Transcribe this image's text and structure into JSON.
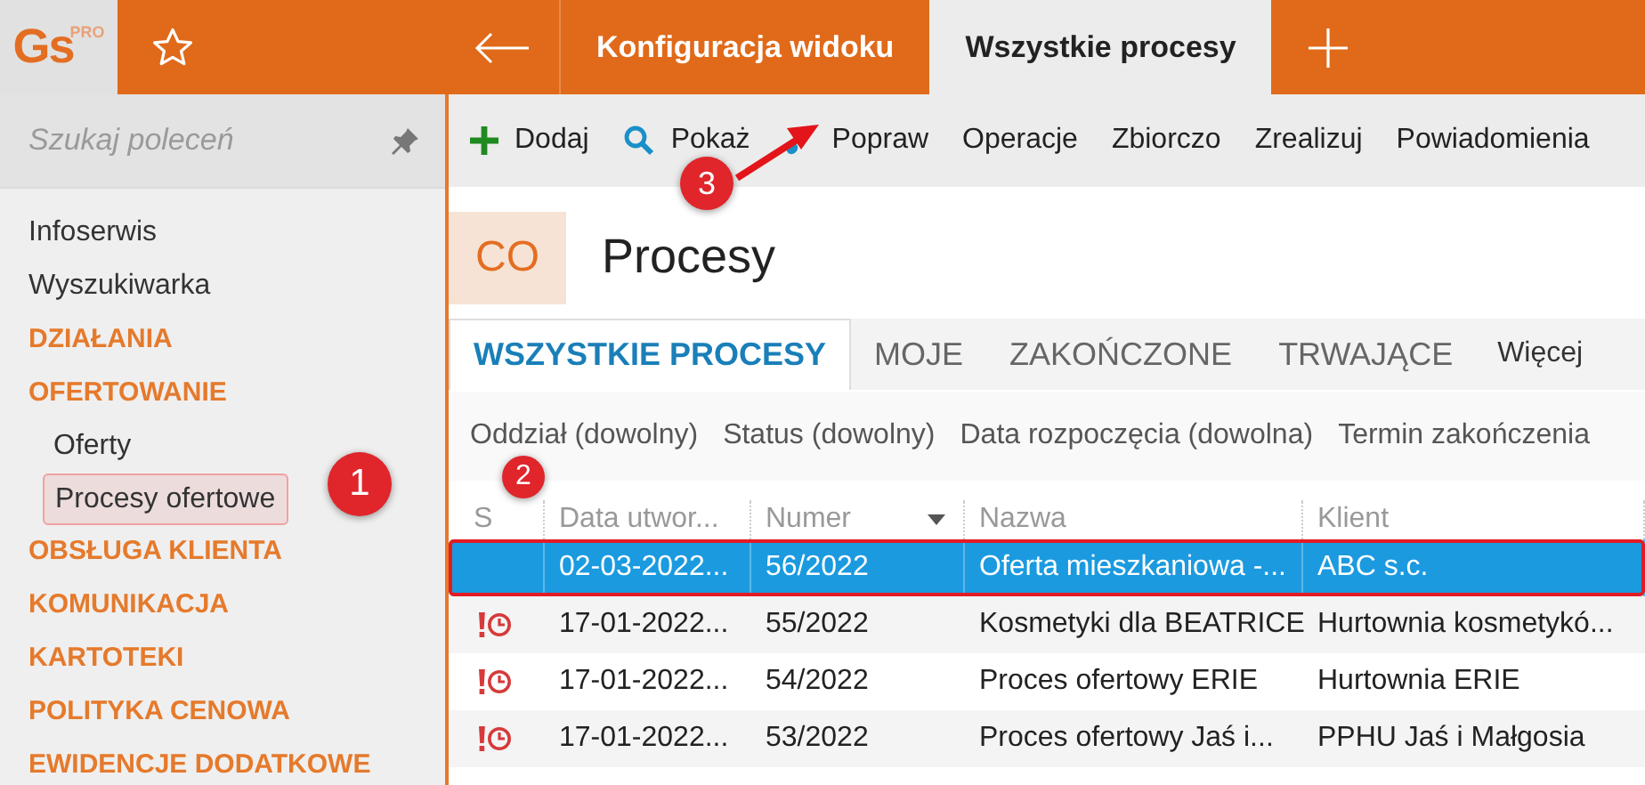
{
  "logo": {
    "text": "Gs",
    "badge": "PRO"
  },
  "top_tabs": [
    {
      "label": "Konfiguracja widoku",
      "selected": false
    },
    {
      "label": "Wszystkie procesy",
      "selected": true
    }
  ],
  "sidebar": {
    "search": {
      "placeholder": "Szukaj poleceń"
    },
    "items": [
      {
        "label": "Infoserwis",
        "kind": "link"
      },
      {
        "label": "Wyszukiwarka",
        "kind": "link"
      },
      {
        "label": "DZIAŁANIA",
        "kind": "section"
      },
      {
        "label": "OFERTOWANIE",
        "kind": "section",
        "children": [
          {
            "label": "Oferty",
            "selected": false
          },
          {
            "label": "Procesy ofertowe",
            "selected": true
          }
        ]
      },
      {
        "label": "OBSŁUGA KLIENTA",
        "kind": "section"
      },
      {
        "label": "KOMUNIKACJA",
        "kind": "section"
      },
      {
        "label": "KARTOTEKI",
        "kind": "section"
      },
      {
        "label": "POLITYKA CENOWA",
        "kind": "section"
      },
      {
        "label": "EWIDENCJE DODATKOWE",
        "kind": "section"
      }
    ]
  },
  "toolbar": [
    {
      "label": "Dodaj",
      "kind": "add"
    },
    {
      "label": "Pokaż",
      "kind": "search"
    },
    {
      "label": "Popraw",
      "kind": "edit"
    },
    {
      "label": "Operacje",
      "kind": "plain"
    },
    {
      "label": "Zbiorczo",
      "kind": "plain"
    },
    {
      "label": "Zrealizuj",
      "kind": "plain"
    },
    {
      "label": "Powiadomienia",
      "kind": "plain"
    }
  ],
  "header": {
    "badge": "CO",
    "title": "Procesy"
  },
  "view_tabs": [
    {
      "label": "WSZYSTKIE PROCESY",
      "selected": true
    },
    {
      "label": "MOJE",
      "selected": false
    },
    {
      "label": "ZAKOŃCZONE",
      "selected": false
    },
    {
      "label": "TRWAJĄCE",
      "selected": false
    }
  ],
  "more": "Więcej",
  "filters": [
    "Oddział (dowolny)",
    "Status (dowolny)",
    "Data rozpoczęcia (dowolna)",
    "Termin zakończenia"
  ],
  "table": {
    "columns": [
      "S",
      "Data utwor...",
      "Numer",
      "Nazwa",
      "Klient"
    ],
    "rows": [
      {
        "overdue": false,
        "selected": true,
        "cells": [
          "",
          "02-03-2022...",
          "56/2022",
          "Oferta mieszkaniowa -...",
          "ABC s.c."
        ]
      },
      {
        "overdue": true,
        "selected": false,
        "cells": [
          "",
          "17-01-2022...",
          "55/2022",
          "Kosmetyki dla BEATRICE",
          "Hurtownia kosmetykó..."
        ]
      },
      {
        "overdue": true,
        "selected": false,
        "cells": [
          "",
          "17-01-2022...",
          "54/2022",
          "Proces ofertowy ERIE",
          "Hurtownia ERIE"
        ]
      },
      {
        "overdue": true,
        "selected": false,
        "cells": [
          "",
          "17-01-2022...",
          "53/2022",
          "Proces ofertowy Jaś i...",
          "PPHU Jaś i Małgosia"
        ]
      }
    ]
  },
  "callouts": [
    "1",
    "2",
    "3"
  ]
}
